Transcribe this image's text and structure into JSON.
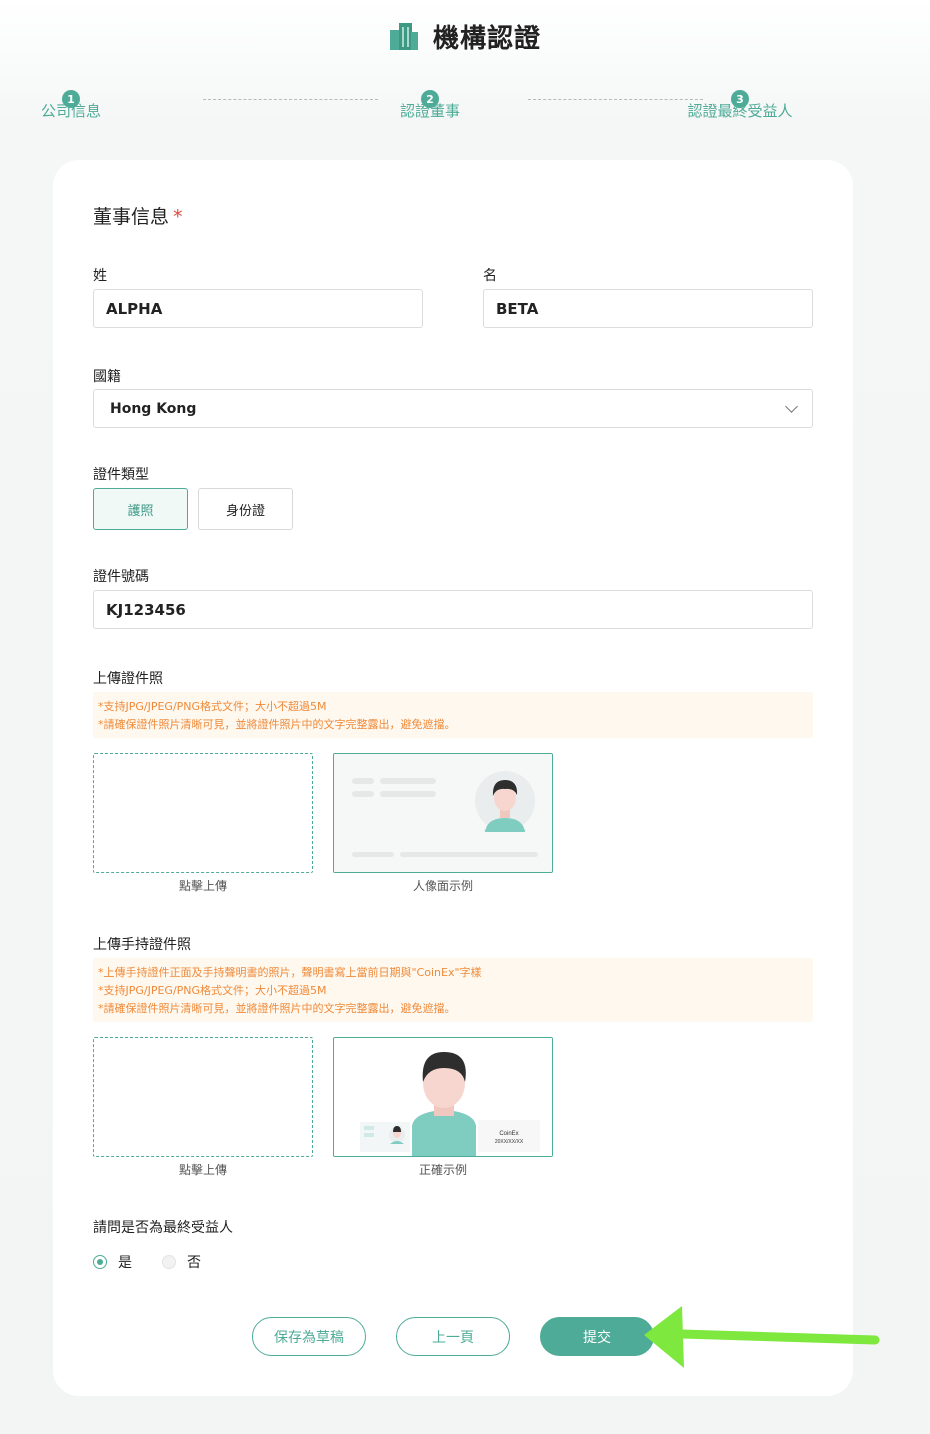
{
  "header": {
    "title": "機構認證"
  },
  "steps": [
    {
      "num": "1",
      "label": "公司信息"
    },
    {
      "num": "2",
      "label": "認證董事"
    },
    {
      "num": "3",
      "label": "認證最終受益人"
    }
  ],
  "form": {
    "section_title": "董事信息",
    "required_mark": "*",
    "last_name_label": "姓",
    "last_name_value": "ALPHA",
    "first_name_label": "名",
    "first_name_value": "BETA",
    "nationality_label": "國籍",
    "nationality_value": "Hong Kong",
    "doc_type_label": "證件類型",
    "doc_types": [
      "護照",
      "身份證"
    ],
    "doc_number_label": "證件號碼",
    "doc_number_value": "KJ123456",
    "upload_id_label": "上傳證件照",
    "upload_id_notes": [
      "*支持JPG/JPEG/PNG格式文件；大小不超過5M",
      "*請確保證件照片清晰可見，並將證件照片中的文字完整露出，避免遮擋。"
    ],
    "upload_caption": "點擊上傳",
    "id_sample_caption": "人像面示例",
    "upload_hold_label": "上傳手持證件照",
    "upload_hold_notes": [
      "*上傳手持證件正面及手持聲明書的照片，聲明書寫上當前日期與\"CoinEx\"字樣",
      "*支持JPG/JPEG/PNG格式文件；大小不超過5M",
      "*請確保證件照片清晰可見，並將證件照片中的文字完整露出，避免遮擋。"
    ],
    "hold_sample_caption": "正確示例",
    "hold_sample_paper": [
      "CoinEx",
      "20XX/XX/XX"
    ],
    "ubo_question": "請問是否為最終受益人",
    "ubo_yes": "是",
    "ubo_no": "否"
  },
  "buttons": {
    "save_draft": "保存為草稿",
    "previous": "上一頁",
    "submit": "提交"
  },
  "colors": {
    "accent": "#4eab97",
    "notice_text": "#ef8a3a",
    "arrow": "#7ee83f"
  }
}
